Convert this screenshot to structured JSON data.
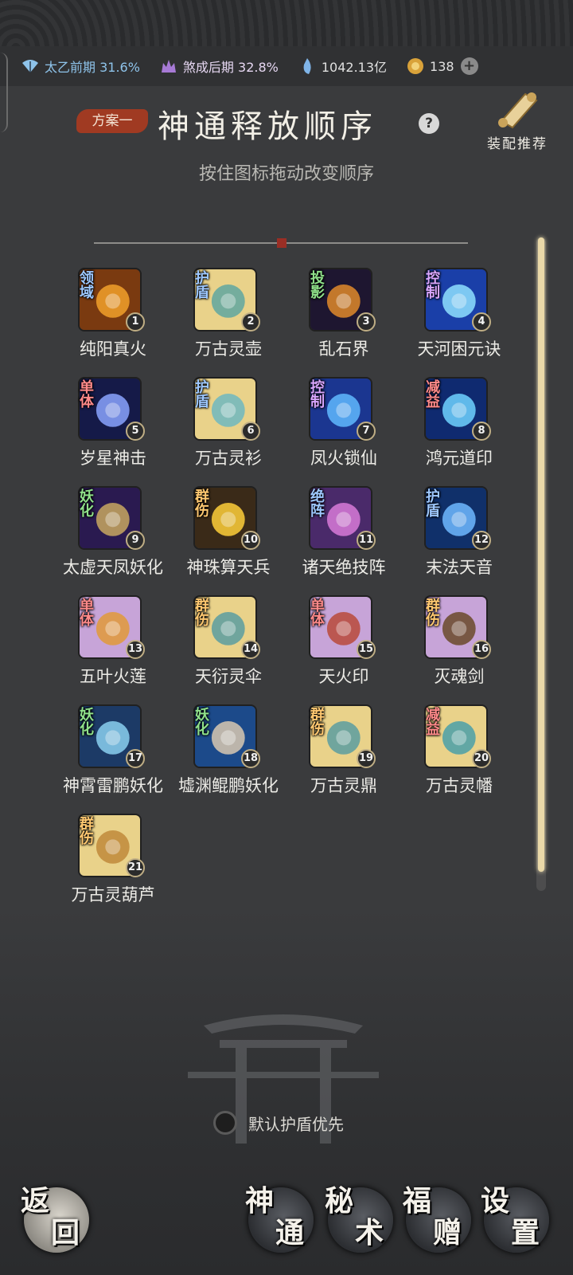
{
  "status": {
    "realm1": {
      "label": "太乙前期 31.6%",
      "icon": "fan-icon"
    },
    "realm2": {
      "label": "煞成后期 32.8%",
      "icon": "crown-icon"
    },
    "stone": {
      "label": "1042.13亿",
      "icon": "spirit-stone-icon"
    },
    "gold": {
      "label": "138",
      "icon": "gold-coin-icon"
    },
    "add_label": "+"
  },
  "header": {
    "plan_label": "方案一",
    "title": "神通释放顺序",
    "help_label": "?",
    "recommend_label": "装配推荐",
    "subtitle": "按住图标拖动改变顺序"
  },
  "skills": [
    {
      "num": "1",
      "name": "纯阳真火",
      "tag": "领域",
      "tag_color": "#9ec8ff",
      "bg": "#7a3a10",
      "fg": "#f2a12a"
    },
    {
      "num": "2",
      "name": "万古灵壶",
      "tag": "护盾",
      "tag_color": "#9ec8ff",
      "bg": "#e9d28a",
      "fg": "#5fa7a0"
    },
    {
      "num": "3",
      "name": "乱石界",
      "tag": "投影",
      "tag_color": "#8fe08a",
      "bg": "#1e1630",
      "fg": "#e08a2a"
    },
    {
      "num": "4",
      "name": "天河困元诀",
      "tag": "控制",
      "tag_color": "#d9a6ff",
      "bg": "#1a3fa8",
      "fg": "#8fe0ff"
    },
    {
      "num": "5",
      "name": "岁星神击",
      "tag": "单体",
      "tag_color": "#ff8a8a",
      "bg": "#151a48",
      "fg": "#8aa4ff"
    },
    {
      "num": "6",
      "name": "万古灵衫",
      "tag": "护盾",
      "tag_color": "#9ec8ff",
      "bg": "#e9d28a",
      "fg": "#6fb9c0"
    },
    {
      "num": "7",
      "name": "凤火锁仙",
      "tag": "控制",
      "tag_color": "#d9a6ff",
      "bg": "#1b3690",
      "fg": "#5fb8ff"
    },
    {
      "num": "8",
      "name": "鸿元道印",
      "tag": "减益",
      "tag_color": "#ff8a8a",
      "bg": "#0f2a70",
      "fg": "#6fd2ff"
    },
    {
      "num": "9",
      "name": "太虚天凤妖化",
      "tag": "妖化",
      "tag_color": "#8fe08a",
      "bg": "#2a1a50",
      "fg": "#c8a860"
    },
    {
      "num": "10",
      "name": "神珠算天兵",
      "tag": "群伤",
      "tag_color": "#ffc870",
      "bg": "#3a2a18",
      "fg": "#ffcf3a"
    },
    {
      "num": "11",
      "name": "诸天绝技阵",
      "tag": "绝阵",
      "tag_color": "#9ec8ff",
      "bg": "#4a2a6a",
      "fg": "#d87ad8"
    },
    {
      "num": "12",
      "name": "末法天音",
      "tag": "护盾",
      "tag_color": "#9ec8ff",
      "bg": "#10306a",
      "fg": "#6fb8ff"
    },
    {
      "num": "13",
      "name": "五叶火莲",
      "tag": "单体",
      "tag_color": "#ff8a8a",
      "bg": "#c7a4d8",
      "fg": "#e09a3a"
    },
    {
      "num": "14",
      "name": "天衍灵伞",
      "tag": "群伤",
      "tag_color": "#ffc870",
      "bg": "#e9d28a",
      "fg": "#5a9ea0"
    },
    {
      "num": "15",
      "name": "天火印",
      "tag": "单体",
      "tag_color": "#ff8a8a",
      "bg": "#c7a4d8",
      "fg": "#b84a3a"
    },
    {
      "num": "16",
      "name": "灭魂剑",
      "tag": "群伤",
      "tag_color": "#ffc870",
      "bg": "#c7a4d8",
      "fg": "#6a4a2a"
    },
    {
      "num": "17",
      "name": "神霄雷鹏妖化",
      "tag": "妖化",
      "tag_color": "#8fe08a",
      "bg": "#1c3a66",
      "fg": "#8ad0f0"
    },
    {
      "num": "18",
      "name": "墟渊鲲鹏妖化",
      "tag": "妖化",
      "tag_color": "#8fe08a",
      "bg": "#1c4a8a",
      "fg": "#d8c8b0"
    },
    {
      "num": "19",
      "name": "万古灵鼎",
      "tag": "群伤",
      "tag_color": "#ffc870",
      "bg": "#e9d28a",
      "fg": "#5a9ea0"
    },
    {
      "num": "20",
      "name": "万古灵幡",
      "tag": "减益",
      "tag_color": "#ff8a8a",
      "bg": "#e9d28a",
      "fg": "#4aa0a8"
    },
    {
      "num": "21",
      "name": "万古灵葫芦",
      "tag": "群伤",
      "tag_color": "#ffc870",
      "bg": "#e9d28a",
      "fg": "#c08a3a"
    }
  ],
  "footer": {
    "shield_label": "默认护盾优先",
    "back": [
      "返",
      "回"
    ],
    "shentong": [
      "神",
      "通"
    ],
    "mishu": [
      "秘",
      "术"
    ],
    "fuzeng": [
      "福",
      "赠"
    ],
    "settings": [
      "设",
      "置"
    ]
  }
}
